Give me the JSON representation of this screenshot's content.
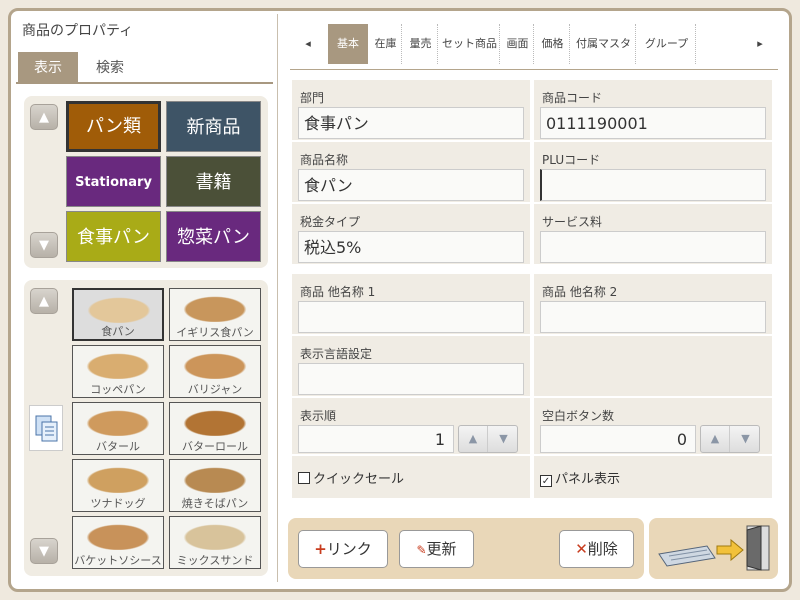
{
  "panel": {
    "title": "商品のプロパティ",
    "tabs": [
      "表示",
      "検索"
    ]
  },
  "categories": [
    {
      "label": "パン類",
      "bg": "#a05c08",
      "fg": "#ffffff"
    },
    {
      "label": "新商品",
      "bg": "#3e5466",
      "fg": "#ffffff"
    },
    {
      "label": "Stationary",
      "bg": "#69297e",
      "fg": "#ffffff"
    },
    {
      "label": "書籍",
      "bg": "#4b5038",
      "fg": "#ffffff"
    },
    {
      "label": "食事パン",
      "bg": "#a9ab17",
      "fg": "#ffffff"
    },
    {
      "label": "惣菜パン",
      "bg": "#69297e",
      "fg": "#ffffff"
    }
  ],
  "products": [
    {
      "label": "食パン",
      "color": "#e3c79a"
    },
    {
      "label": "イギリス食パン",
      "color": "#c8965c"
    },
    {
      "label": "コッペパン",
      "color": "#d9ad70"
    },
    {
      "label": "バリジャン",
      "color": "#cc955a"
    },
    {
      "label": "バタール",
      "color": "#cf9a5d"
    },
    {
      "label": "バターロール",
      "color": "#b27434"
    },
    {
      "label": "ツナドッグ",
      "color": "#cfa060"
    },
    {
      "label": "焼きそばパン",
      "color": "#b88a52"
    },
    {
      "label": "バケットソシース",
      "color": "#c8925a"
    },
    {
      "label": "ミックスサンド",
      "color": "#d8c39b"
    }
  ],
  "right_tabs": [
    "基本",
    "在庫",
    "量売",
    "セット商品",
    "画面",
    "価格",
    "付属マスタ",
    "グループ"
  ],
  "form": {
    "dept_label": "部門",
    "dept_value": "食事パン",
    "code_label": "商品コード",
    "code_value": "0111190001",
    "name_label": "商品名称",
    "name_value": "食パン",
    "plu_label": "PLUコード",
    "plu_value": "",
    "tax_label": "税金タイプ",
    "tax_value": "税込5%",
    "service_label": "サービス料",
    "service_value": "",
    "alt1_label": "商品 他名称 1",
    "alt1_value": "",
    "alt2_label": "商品 他名称 2",
    "alt2_value": "",
    "lang_label": "表示言語設定",
    "lang_value": "",
    "order_label": "表示順",
    "order_value": "1",
    "blank_label": "空白ボタン数",
    "blank_value": "0",
    "quick_label": "クイックセール",
    "panel_label": "パネル表示"
  },
  "footer": {
    "link": "リンク",
    "update": "更新",
    "delete": "削除"
  }
}
